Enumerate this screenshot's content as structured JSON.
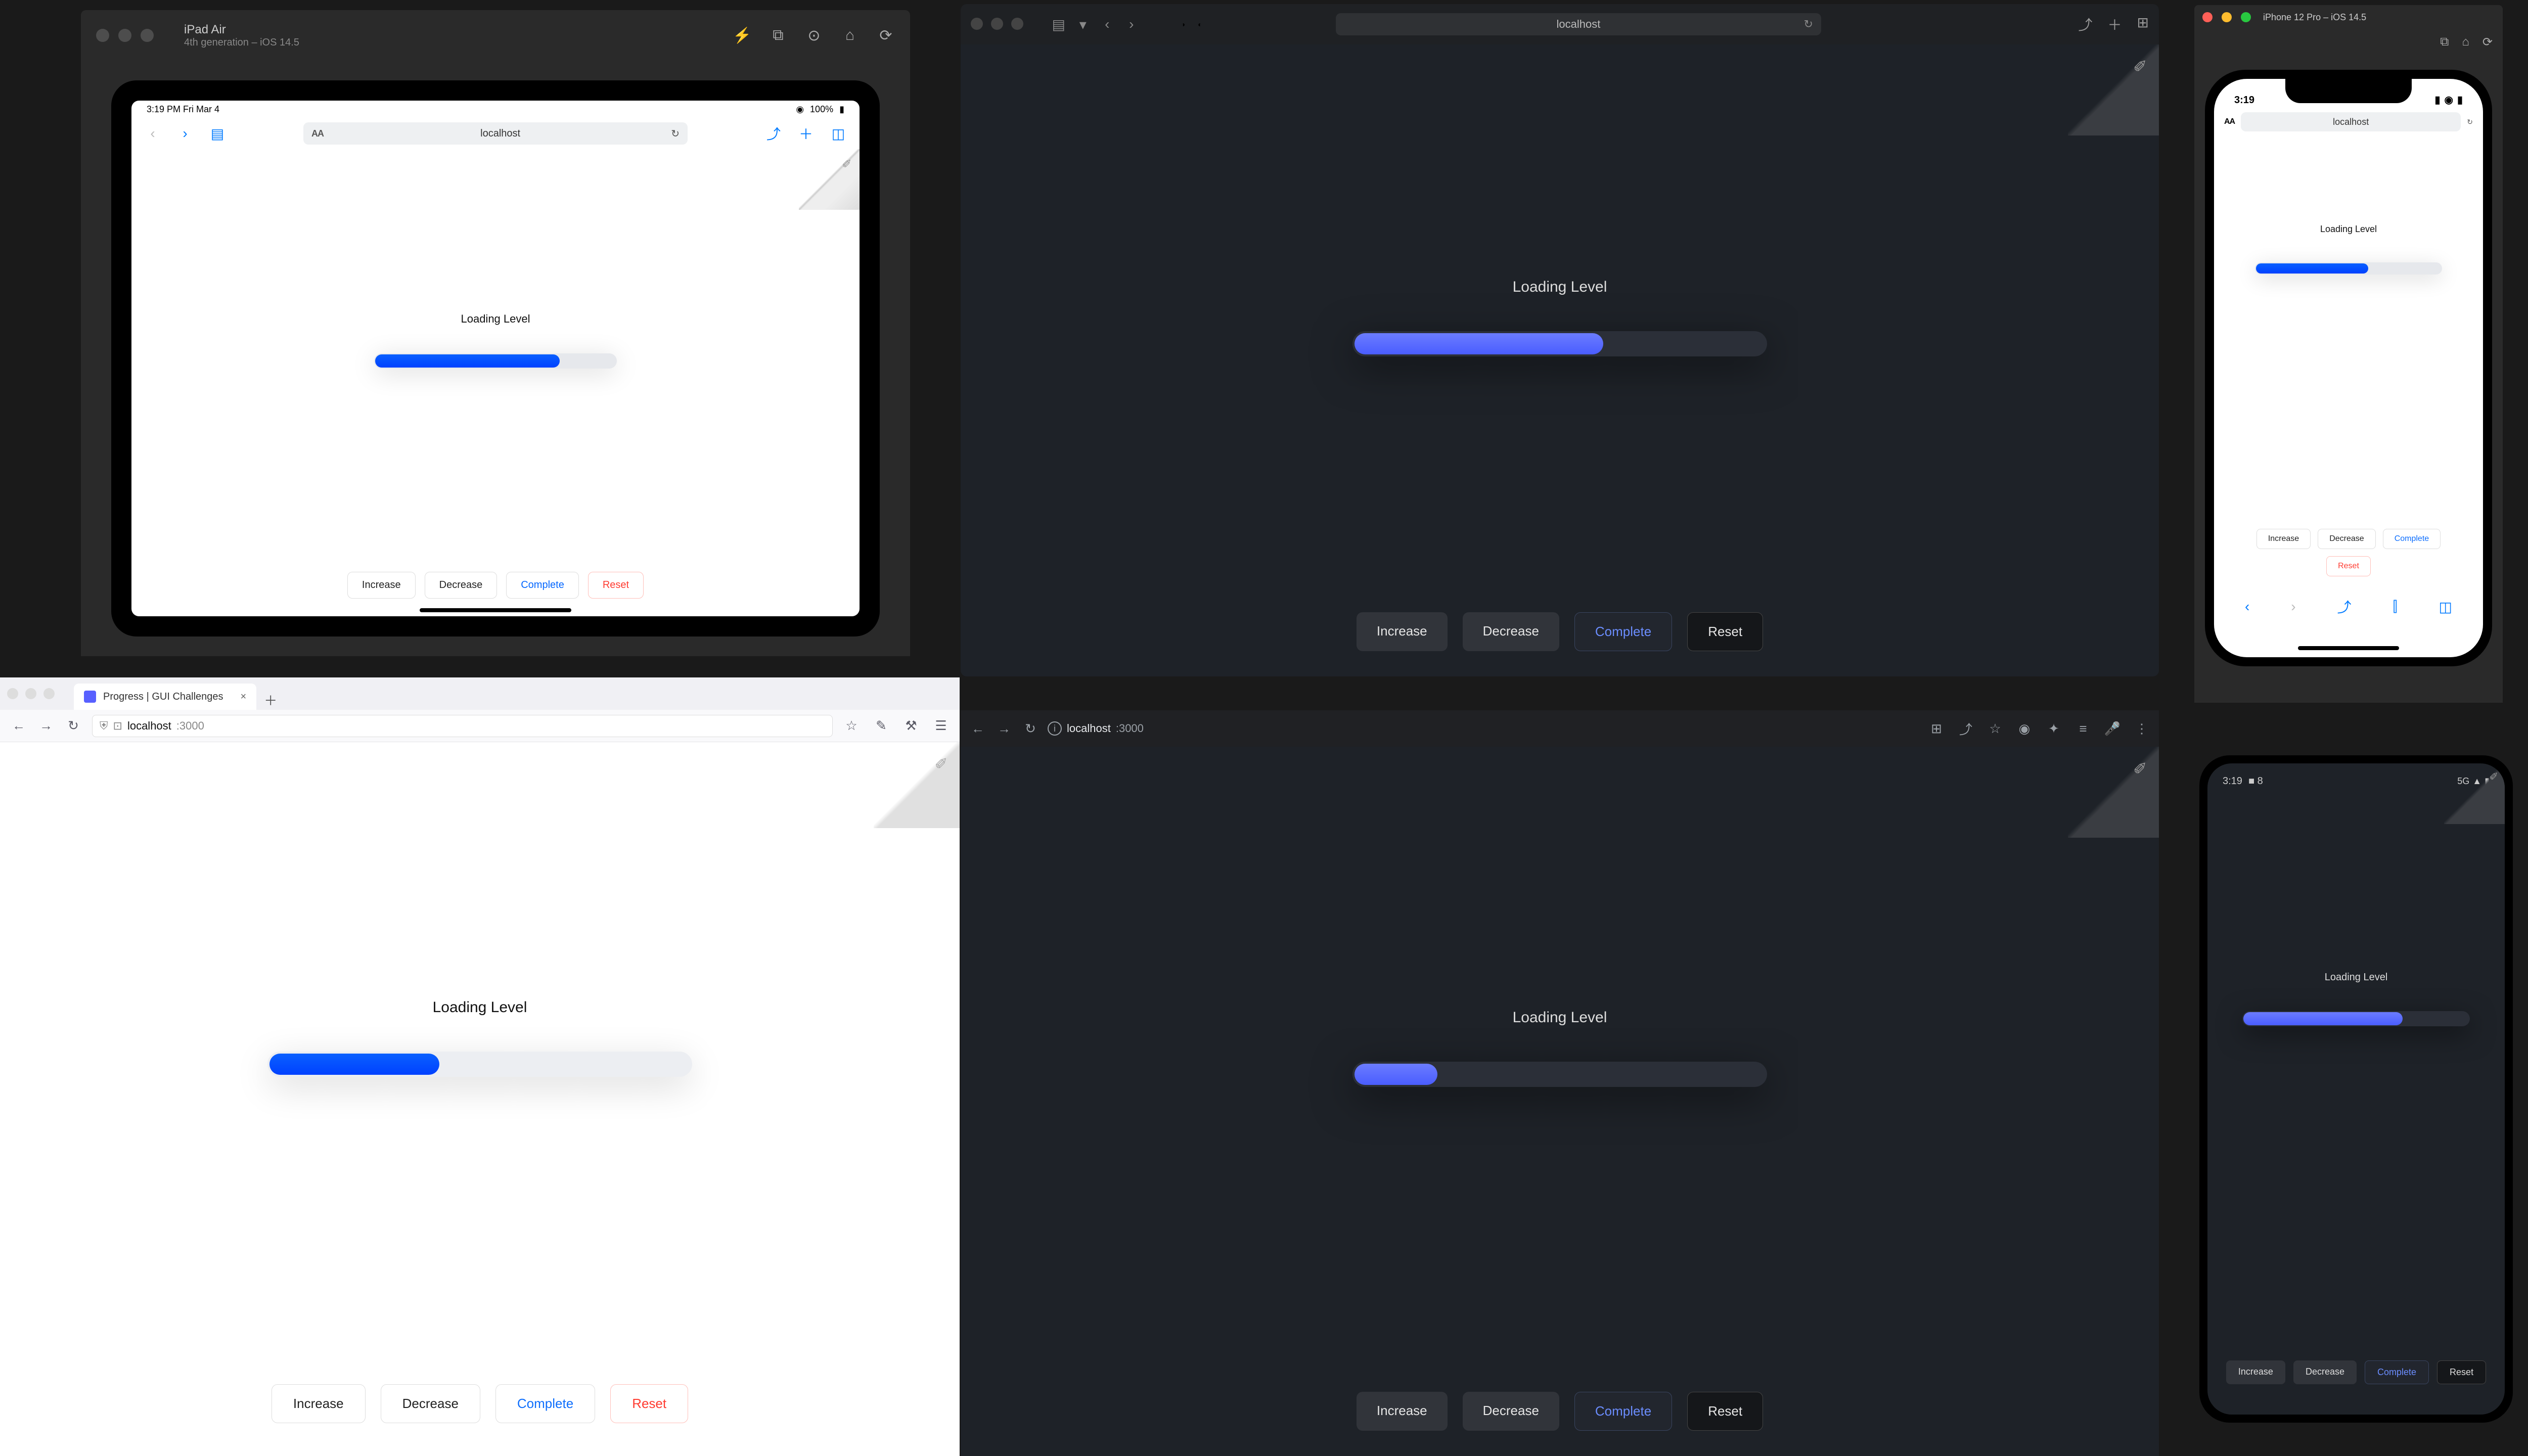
{
  "demo": {
    "label": "Loading Level",
    "buttons": {
      "increase": "Increase",
      "decrease": "Decrease",
      "complete": "Complete",
      "reset": "Reset"
    }
  },
  "progress": {
    "ipad_pct": 76,
    "safari_dark_pct": 60,
    "firefox_pct": 40,
    "chrome_dark_pct": 20,
    "iphone_pct": 60,
    "android_pct": 70
  },
  "ipad_sim": {
    "device": "iPad Air",
    "os": "4th generation – iOS 14.5",
    "status_time": "3:19 PM   Fri Mar 4",
    "status_wifi": "􀙇",
    "status_batt_label": "100%",
    "safari": {
      "host": "localhost",
      "aa_label": "AA"
    }
  },
  "safari_dark": {
    "url_host": "localhost"
  },
  "firefox": {
    "tab_title": "Progress | GUI Challenges",
    "url_host": "localhost",
    "url_port": ":3000"
  },
  "chrome_dark": {
    "url_host": "localhost",
    "url_port": ":3000"
  },
  "iphone_sim": {
    "title": "iPhone 12 Pro – iOS 14.5",
    "status_time": "3:19",
    "safari_host": "localhost",
    "aa_label": "AA"
  },
  "android": {
    "status_time": "3:19",
    "status_net": "5G",
    "notif_icons": "■ 8"
  },
  "colors": {
    "accent_blue_light": "#0a60ff",
    "accent_blue_dark": "#6b7cff",
    "danger": "#ff3b30"
  },
  "icons": {
    "share": "⤴",
    "plus": "＋",
    "tabs": "◫",
    "reload": "↻",
    "back": "‹",
    "fwd": "›",
    "sidebar": "▤",
    "aa": "AA",
    "book": "⫿",
    "shield": "⛨",
    "lock": "🔒",
    "star": "☆",
    "menu": "☰",
    "ext": "✦",
    "download": "⬇",
    "home": "⌂",
    "camera": "📷",
    "screenshot": "⧉",
    "gear": "⚙",
    "power": "⏻",
    "vol_up": "🔊",
    "vol_dn": "🔉",
    "rot_l": "◇",
    "rot_r": "◆",
    "zoom": "🔍",
    "a_back": "◁",
    "a_home": "○",
    "a_overview": "□",
    "more": "⋯",
    "info": "i",
    "grid": "⊞",
    "location": "◑"
  }
}
